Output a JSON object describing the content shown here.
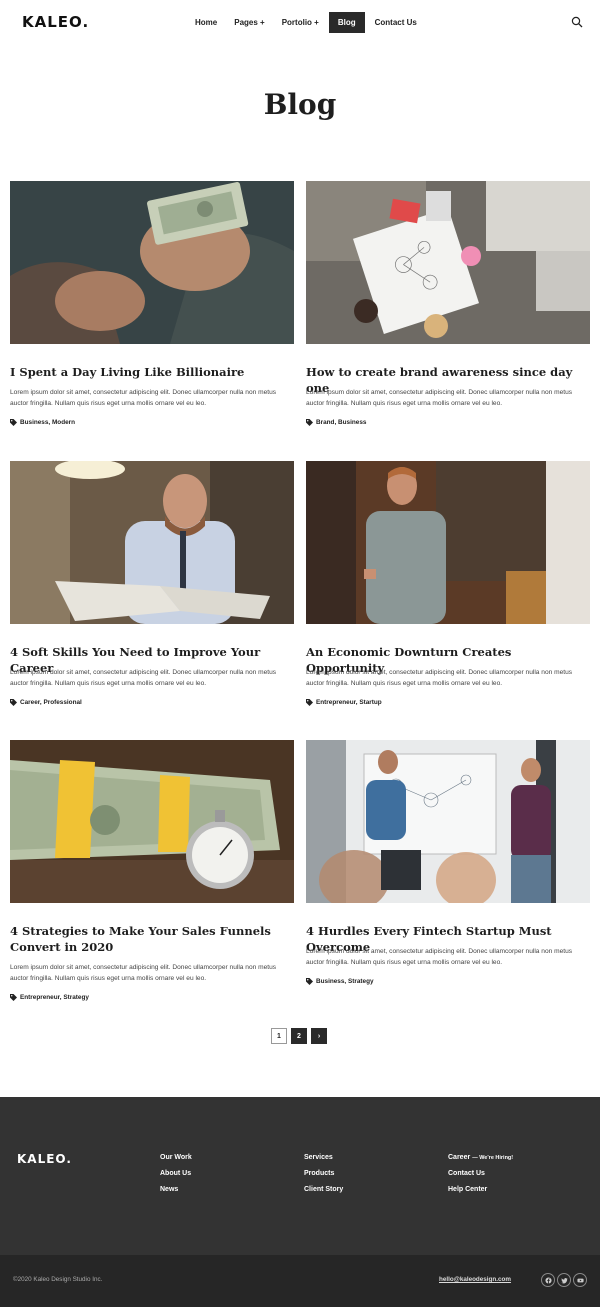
{
  "header": {
    "logo": "KALEO.",
    "nav": [
      {
        "label": "Home"
      },
      {
        "label": "Pages +"
      },
      {
        "label": "Portolio +"
      },
      {
        "label": "Blog"
      },
      {
        "label": "Contact Us"
      }
    ],
    "search_icon": "search-icon"
  },
  "page": {
    "title": "Blog"
  },
  "posts": [
    {
      "title": "I Spent a Day Living Like Billionaire",
      "excerpt": "Lorem ipsum dolor sit amet, consectetur adipiscing elit. Donec ullamcorper nulla non metus auctor fringilla. Nullam quis risus eget urna mollis ornare vel eu leo.",
      "tags": "Business, Modern",
      "image": "hands-counting-money"
    },
    {
      "title": "How to create brand awareness since day one",
      "excerpt": "Lorem ipsum dolor sit amet, consectetur adipiscing elit. Donec ullamcorper nulla non metus auctor fringilla. Nullam quis risus eget urna mollis ornare vel eu leo.",
      "tags": "Brand, Business",
      "image": "desk-with-diagram"
    },
    {
      "title": "4 Soft Skills You Need to Improve Your Career",
      "excerpt": "Lorem ipsum dolor sit amet, consectetur adipiscing elit. Donec ullamcorper nulla non metus auctor fringilla. Nullam quis risus eget urna mollis ornare vel eu leo.",
      "tags": "Career, Professional",
      "image": "man-reading-newspaper"
    },
    {
      "title": "An Economic Downturn Creates Opportunity",
      "excerpt": "Lorem ipsum dolor sit amet, consectetur adipiscing elit. Donec ullamcorper nulla non metus auctor fringilla. Nullam quis risus eget urna mollis ornare vel eu leo.",
      "tags": "Entrepreneur, Startup",
      "image": "man-with-phone"
    },
    {
      "title": "4 Strategies to Make Your Sales Funnels Convert in 2020",
      "excerpt": "Lorem ipsum dolor sit amet, consectetur adipiscing elit. Donec ullamcorper nulla non metus auctor fringilla. Nullam quis risus eget urna mollis ornare vel eu leo.",
      "tags": "Entrepreneur, Strategy",
      "image": "money-and-stopwatch"
    },
    {
      "title": "4 Hurdles Every Fintech Startup Must Overcome",
      "excerpt": "Lorem ipsum dolor sit amet, consectetur adipiscing elit. Donec ullamcorper nulla non metus auctor fringilla. Nullam quis risus eget urna mollis ornare vel eu leo.",
      "tags": "Business, Strategy",
      "image": "office-whiteboard-meeting"
    }
  ],
  "pagination": {
    "pages": [
      "1",
      "2"
    ],
    "next": "›",
    "current": "2"
  },
  "footer": {
    "logo": "KALEO.",
    "col1": [
      "Our Work",
      "About Us",
      "News"
    ],
    "col2": [
      "Services",
      "Products",
      "Client Story"
    ],
    "col3": {
      "career": "Career",
      "hiring": "— We're Hiring!",
      "contact": "Contact Us",
      "help": "Help Center"
    },
    "copyright": "©2020 Kaleo Design Studio Inc.",
    "email": "hello@kaleodesign.com",
    "social": [
      "facebook-icon",
      "twitter-icon",
      "youtube-icon"
    ]
  },
  "colors": {
    "dark": "#2a2a2a",
    "footer": "#333333",
    "bottom_bar": "#262626"
  }
}
